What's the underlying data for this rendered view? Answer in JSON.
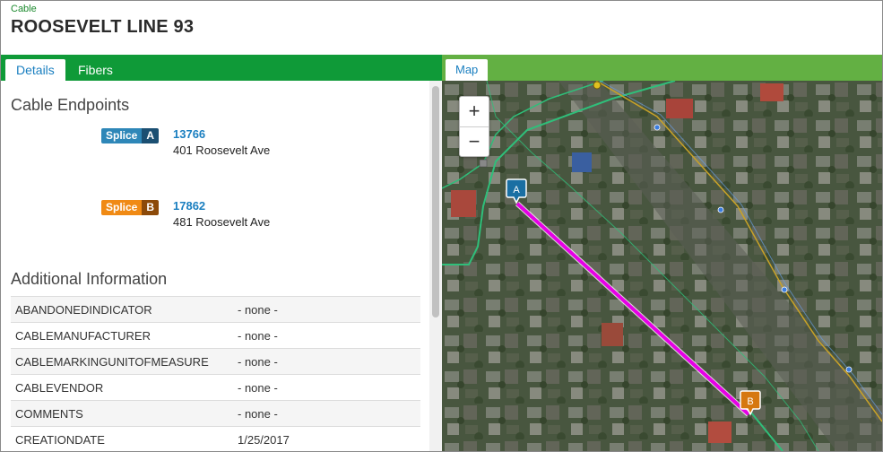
{
  "header": {
    "type": "Cable",
    "title": "ROOSEVELT LINE 93"
  },
  "tabs_left": [
    {
      "label": "Details",
      "active": true
    },
    {
      "label": "Fibers",
      "active": false
    }
  ],
  "tabs_right": [
    {
      "label": "Map",
      "active": true
    }
  ],
  "endpoints": {
    "title": "Cable Endpoints",
    "a": {
      "type": "Splice",
      "letter": "A",
      "id": "13766",
      "address": "401 Roosevelt Ave"
    },
    "b": {
      "type": "Splice",
      "letter": "B",
      "id": "17862",
      "address": "481 Roosevelt Ave"
    }
  },
  "additional": {
    "title": "Additional Information",
    "rows": [
      {
        "key": "ABANDONEDINDICATOR",
        "value": "- none -"
      },
      {
        "key": "CABLEMANUFACTURER",
        "value": "- none -"
      },
      {
        "key": "CABLEMARKINGUNITOFMEASURE",
        "value": "- none -"
      },
      {
        "key": "CABLEVENDOR",
        "value": "- none -"
      },
      {
        "key": "COMMENTS",
        "value": "- none -"
      },
      {
        "key": "CREATIONDATE",
        "value": "1/25/2017"
      }
    ]
  },
  "map": {
    "zoom_in": "+",
    "zoom_out": "−",
    "marker_a": "A",
    "marker_b": "B",
    "colors": {
      "cable": "#e600e6",
      "marker_a": "#1a6fa3",
      "marker_b": "#d67810",
      "roads": "#2fbf7a",
      "gas": "#c9a227"
    }
  }
}
